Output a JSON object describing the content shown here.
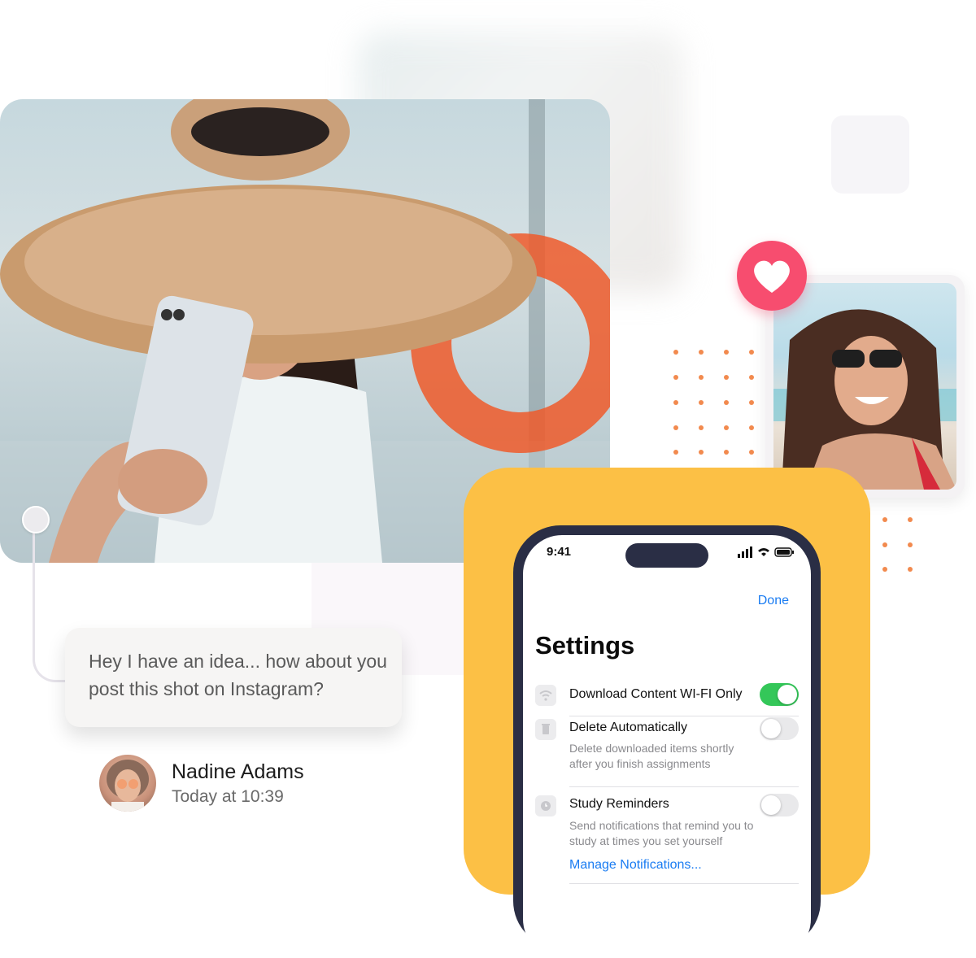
{
  "chat": {
    "message": "Hey I have an idea... how about you post this shot on Instagram?",
    "author_name": "Nadine Adams",
    "timestamp": "Today at 10:39"
  },
  "phone": {
    "status_time": "9:41",
    "done_label": "Done",
    "title": "Settings",
    "rows": [
      {
        "label": "Download Content WI-FI Only",
        "icon": "wifi-icon",
        "toggle_on": true
      },
      {
        "label": "Delete Automatically",
        "icon": "trash-icon",
        "toggle_on": false,
        "description": "Delete downloaded items shortly after you finish assignments"
      },
      {
        "label": "Study Reminders",
        "icon": "clock-icon",
        "toggle_on": false,
        "description": "Send notifications that remind you to study at times you set yourself",
        "link": "Manage Notifications..."
      }
    ]
  },
  "badges": {
    "heart": "heart-icon"
  },
  "colors": {
    "accent_yellow": "#fcc045",
    "heart_pink": "#f74d6f",
    "toggle_green": "#34c759",
    "link_blue": "#1a7cf2",
    "dot_orange": "#f28a4e"
  }
}
